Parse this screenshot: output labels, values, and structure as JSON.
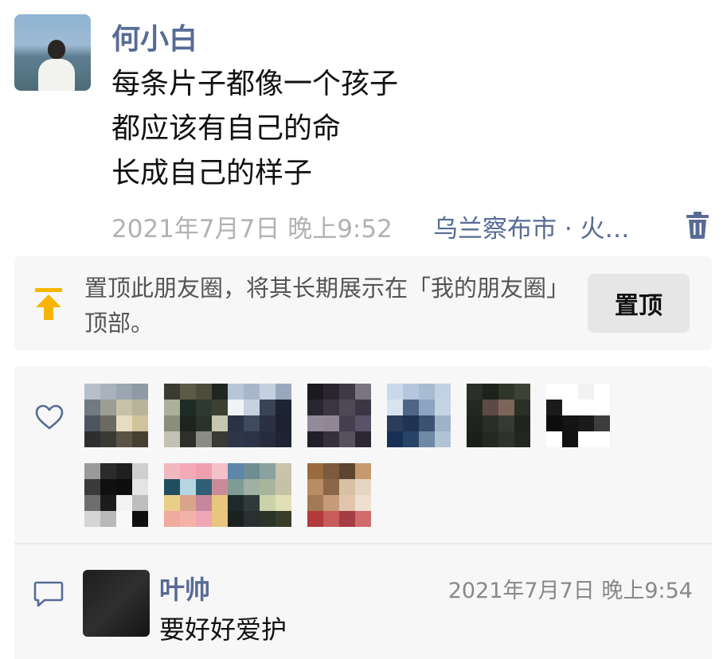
{
  "post": {
    "author": "何小白",
    "lines": [
      "每条片子都像一个孩子",
      "都应该有自己的命",
      "长成自己的样子"
    ],
    "time": "2021年7月7日 晚上9:52",
    "location": "乌兰察布市 · 火…",
    "icons": {
      "avatar": "user-avatar",
      "delete": "trash-icon"
    }
  },
  "pin": {
    "text": "置顶此朋友圈，将其长期展示在「我的朋友圈」顶部。",
    "button_label": "置顶",
    "icon": "pin-top-icon",
    "icon_color": "#f7b500"
  },
  "likes": {
    "icon": "heart-icon",
    "avatars": [
      {
        "colors": [
          "#b6c0cb",
          "#a9b2bd",
          "#9aa6b2",
          "#8f9aa5",
          "#6f7a83",
          "#9b9e95",
          "#c6c1a8",
          "#b8b49a",
          "#4d5560",
          "#6b6b5f",
          "#e6dcc2",
          "#d0c29b",
          "#2c2e2f",
          "#3a3a35",
          "#5b5446",
          "#453f30"
        ]
      },
      {
        "colors": [
          "#3b3b33",
          "#5b5a45",
          "#4d4b39",
          "#202521",
          "#aab09a",
          "#1f2b25",
          "#2e3a2f",
          "#3c4032",
          "#8a8f7c",
          "#1d231f",
          "#2a332a",
          "#c7c6b0",
          "#c2c1b4",
          "#2e2f2a",
          "#8b8c85",
          "#3a3b35"
        ]
      },
      {
        "colors": [
          "#b7c5d8",
          "#a9b7cc",
          "#c4cfe0",
          "#9aa8be",
          "#f2f3f6",
          "#c8d1df",
          "#3a4457",
          "#1d2433",
          "#2a3244",
          "#404a5f",
          "#2b3142",
          "#1c2230",
          "#2e3647",
          "#2b3346",
          "#262c3d",
          "#1e2433"
        ]
      },
      {
        "colors": [
          "#1b1a1f",
          "#2a2630",
          "#3d3945",
          "#7a7380",
          "#2a2631",
          "#3b3541",
          "#4f4856",
          "#3c3543",
          "#908a99",
          "#8f8796",
          "#454050",
          "#59536a",
          "#231f29",
          "#36303c",
          "#57505d",
          "#2b2733"
        ]
      },
      {
        "colors": [
          "#c9d9ea",
          "#b5c7dc",
          "#a7bbd2",
          "#c2d2e4",
          "#d8e3ef",
          "#4d6686",
          "#8ca4c0",
          "#c5d4e4",
          "#2a3e5c",
          "#1f3454",
          "#3b5272",
          "#9fb3c8",
          "#183056",
          "#274467",
          "#6f88a6",
          "#b1c3d6"
        ]
      },
      {
        "colors": [
          "#2a2f27",
          "#1e221c",
          "#303529",
          "#3d4236",
          "#232820",
          "#5b4a44",
          "#7d6459",
          "#2b3026",
          "#1f231c",
          "#2a2f25",
          "#363b31",
          "#20241d",
          "#1b1f19",
          "#252a21",
          "#2f342a",
          "#232720"
        ]
      },
      {
        "colors": [
          "#ffffff",
          "#ffffff",
          "#f2f2f2",
          "#ffffff",
          "#1a1a1a",
          "#ffffff",
          "#ffffff",
          "#ffffff",
          "#0d0d0d",
          "#141414",
          "#1a1a1a",
          "#3d3d3d",
          "#ffffff",
          "#111111",
          "#ffffff",
          "#ffffff"
        ]
      },
      {
        "colors": [
          "#9a9a9a",
          "#2b2b2b",
          "#1f1f1f",
          "#cfcfcf",
          "#3a3a3a",
          "#101010",
          "#0d0d0d",
          "#e4e4e4",
          "#6e6e6e",
          "#1c1c1c",
          "#f3f3f3",
          "#bdbdbd",
          "#d5d5d5",
          "#b9b9b9",
          "#f9f9f9",
          "#0f0f0f"
        ]
      },
      {
        "colors": [
          "#f2b8c0",
          "#f3a9b6",
          "#ee9fb0",
          "#f4c1c8",
          "#1f4e5f",
          "#b4d7e3",
          "#2f5f74",
          "#c98b9a",
          "#e8cf88",
          "#d9a58a",
          "#c6869b",
          "#e7c77c",
          "#f0ab9e",
          "#f3b3a8",
          "#f0a7b5",
          "#e9c47d"
        ]
      },
      {
        "colors": [
          "#5d86a9",
          "#6f8e92",
          "#8aa2a0",
          "#c8c3aa",
          "#7e9c93",
          "#9fb0a4",
          "#a8b59d",
          "#c6c2a8",
          "#1e2a2a",
          "#2f3b3b",
          "#c9d2a9",
          "#e1dfb5",
          "#1b2020",
          "#283030",
          "#2a3428",
          "#3a3d2a"
        ]
      },
      {
        "colors": [
          "#9a6b3f",
          "#7b5a3d",
          "#5d4530",
          "#c59a6f",
          "#b88c64",
          "#8b6647",
          "#d7c1a5",
          "#e6d5c2",
          "#a37a56",
          "#c79b7a",
          "#e2c4ad",
          "#efdfd0",
          "#b23a3a",
          "#c85b5b",
          "#a53d44",
          "#d06b6b"
        ]
      }
    ]
  },
  "comment": {
    "icon": "comment-icon",
    "name": "叶帅",
    "time": "2021年7月7日 晚上9:54",
    "text": "要好好爱护"
  }
}
